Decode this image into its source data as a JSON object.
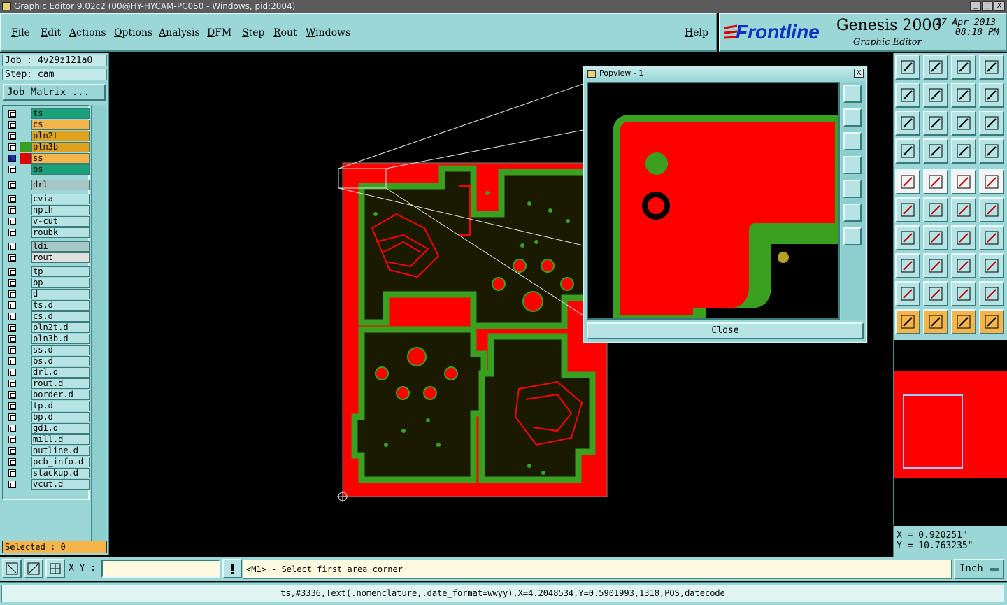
{
  "window": {
    "title": "Graphic Editor 9.02c2 (00@HY-HYCAM-PC050 - Windows, pid:2004)",
    "buttons": [
      "_",
      "□",
      "X"
    ]
  },
  "menu": {
    "items": [
      "File",
      "Edit",
      "Actions",
      "Options",
      "Analysis",
      "DFM",
      "Step",
      "Rout",
      "Windows"
    ],
    "help": "Help"
  },
  "brand": {
    "logo": "Frontline",
    "product": "Genesis 2000",
    "subtitle": "Graphic Editor",
    "date": "27 Apr 2013",
    "time": "08:18 PM"
  },
  "job": {
    "job_line": "Job : 4v29z121a0",
    "step_line": "Step: cam",
    "matrix_button": "Job Matrix ..."
  },
  "layers": [
    {
      "name": "ts",
      "bg": "#1aa37a",
      "swatch": ""
    },
    {
      "name": "cs",
      "bg": "#f5b54a",
      "swatch": ""
    },
    {
      "name": "pln2t",
      "bg": "#e0a21c",
      "swatch": ""
    },
    {
      "name": "pln3b",
      "bg": "#e0a21c",
      "swatch": "#3aa020"
    },
    {
      "name": "ss",
      "bg": "#f5b54a",
      "swatch": "#e00000",
      "active": true
    },
    {
      "name": "bs",
      "bg": "#1aa37a",
      "swatch": ""
    },
    {
      "name": "drl",
      "bg": "#a8c8c8",
      "swatch": ""
    },
    {
      "name": "cvia",
      "bg": "#b6e4e4",
      "swatch": ""
    },
    {
      "name": "npth",
      "bg": "#b6e4e4",
      "swatch": ""
    },
    {
      "name": "v-cut",
      "bg": "#b6e4e4",
      "swatch": ""
    },
    {
      "name": "roubk",
      "bg": "#b6e4e4",
      "swatch": ""
    },
    {
      "name": "ldi",
      "bg": "#a8c8c8",
      "swatch": ""
    },
    {
      "name": "rout",
      "bg": "#e0e0e0",
      "swatch": ""
    },
    {
      "name": "tp",
      "bg": "#b6e4e4",
      "swatch": ""
    },
    {
      "name": "bp",
      "bg": "#b6e4e4",
      "swatch": ""
    },
    {
      "name": "d",
      "bg": "#b6e4e4",
      "swatch": ""
    },
    {
      "name": "ts.d",
      "bg": "#b6e4e4",
      "swatch": ""
    },
    {
      "name": "cs.d",
      "bg": "#b6e4e4",
      "swatch": ""
    },
    {
      "name": "pln2t.d",
      "bg": "#b6e4e4",
      "swatch": ""
    },
    {
      "name": "pln3b.d",
      "bg": "#b6e4e4",
      "swatch": ""
    },
    {
      "name": "ss.d",
      "bg": "#b6e4e4",
      "swatch": ""
    },
    {
      "name": "bs.d",
      "bg": "#b6e4e4",
      "swatch": ""
    },
    {
      "name": "drl.d",
      "bg": "#b6e4e4",
      "swatch": ""
    },
    {
      "name": "rout.d",
      "bg": "#b6e4e4",
      "swatch": ""
    },
    {
      "name": "border.d",
      "bg": "#b6e4e4",
      "swatch": ""
    },
    {
      "name": "tp.d",
      "bg": "#b6e4e4",
      "swatch": ""
    },
    {
      "name": "bp.d",
      "bg": "#b6e4e4",
      "swatch": ""
    },
    {
      "name": "gd1.d",
      "bg": "#b6e4e4",
      "swatch": ""
    },
    {
      "name": "mill.d",
      "bg": "#b6e4e4",
      "swatch": ""
    },
    {
      "name": "outline.d",
      "bg": "#b6e4e4",
      "swatch": ""
    },
    {
      "name": "pcb_info.d",
      "bg": "#b6e4e4",
      "swatch": ""
    },
    {
      "name": "stackup.d",
      "bg": "#b6e4e4",
      "swatch": ""
    },
    {
      "name": "vcut.d",
      "bg": "#b6e4e4",
      "swatch": ""
    }
  ],
  "selected": "Selected : 0",
  "popview": {
    "title": "Popview - 1",
    "close_x": "X",
    "close_label": "Close"
  },
  "coords": {
    "x": "X = 0.920251\"",
    "y": "Y = 10.763235\""
  },
  "command": {
    "xy_label": "X Y :",
    "xy_value": "",
    "prompt": "<M1> - Select first area corner",
    "units": "Inch"
  },
  "status": {
    "text": "ts,#3336,Text(.nomenclature,.date_format=wwyy),X=4.2048534,Y=0.5901993,1318,POS,datecode"
  },
  "colors": {
    "panel": "#9cd7d7",
    "copper": "#ff0000",
    "soldermask": "#3aa020",
    "accent": "#f5b54a"
  },
  "tool_icons": [
    "zoom-home-icon",
    "zoom-home-icon",
    "home-icon",
    "split-window-icon",
    "pan-left-icon",
    "pan-right-icon",
    "redraw-icon",
    "snake-icon",
    "fit-icon",
    "center-icon",
    "scale-1-2-icon",
    "help-icon",
    "measure-icon",
    "grid-icon",
    "snap-icon",
    "snap-icon",
    "add-feature-icon",
    "route-icon",
    "ruler-icon",
    "pad-icon",
    "connect-icon",
    "delete-icon",
    "move-icon",
    "move-icon",
    "angle-icon",
    "line-icon",
    "arc-icon",
    "text-icon",
    "copy-icon",
    "resize-icon",
    "break-icon",
    "contour-icon",
    "polygon-icon",
    "polygon-icon",
    "polygon-icon",
    "polygon-icon",
    "select-icon",
    "select-box-icon",
    "select-area-icon",
    "select-net-icon"
  ]
}
